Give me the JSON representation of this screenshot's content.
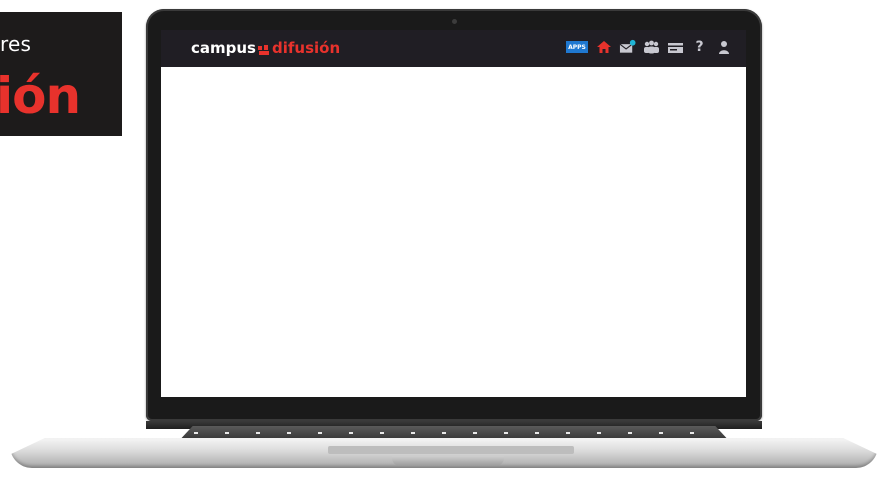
{
  "promo": {
    "line1": "res",
    "line2": "ión"
  },
  "app": {
    "brand_part1": "campus",
    "brand_part2": "difusión",
    "app_badge": "APPS",
    "icons": [
      "apps-icon",
      "home-icon",
      "mail-icon",
      "group-icon",
      "card-icon",
      "help-icon",
      "user-icon"
    ],
    "help_label": "?",
    "colors": {
      "topbar": "#201e24",
      "brand_accent": "#e8322c",
      "apps_badge": "#1f78d1",
      "promo_bg": "#1d1b1b"
    }
  }
}
